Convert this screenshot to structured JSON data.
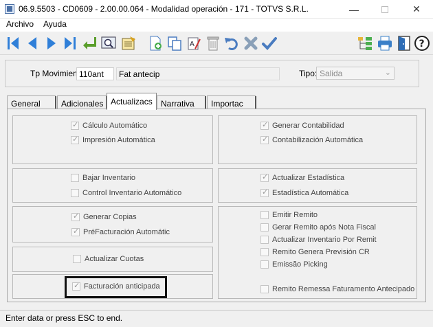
{
  "window": {
    "title": "06.9.5503 - CD0609 - 2.00.00.064 - Modalidad operación - 171 - TOTVS S.R.L.",
    "minimize": "—",
    "close": "✕"
  },
  "menu": [
    "Archivo",
    "Ayuda"
  ],
  "toolbar": {
    "icons": [
      "first-icon",
      "previous-icon",
      "next-icon",
      "last-icon",
      "return-icon",
      "search-icon",
      "list-icon",
      "new-icon",
      "copy-icon",
      "edit-text-icon",
      "delete-icon",
      "undo-icon",
      "cancel-icon",
      "confirm-icon",
      "tree-icon",
      "print-icon",
      "exit-icon",
      "help-icon"
    ],
    "colors": {
      "nav_blue": "#2f7fd8",
      "return_green": "#5a9e2b",
      "cancel_gray": "#8aa0b8"
    }
  },
  "header": {
    "tp_label": "Tp Movimien:",
    "tp_code": "110ant",
    "tp_desc": "Fat antecip",
    "tipo_label": "Tipo:",
    "tipo_value": "Salida"
  },
  "tabs": [
    "General",
    "Adicionales",
    "Actualizacs",
    "Narrativa",
    "Importac"
  ],
  "active_tab": "Actualizacs",
  "options": {
    "calculo": {
      "label": "Cálculo Automático",
      "checked": true
    },
    "impresion": {
      "label": "Impresión Automática",
      "checked": true
    },
    "gen_contab": {
      "label": "Generar Contabilidad",
      "checked": true
    },
    "contab_auto": {
      "label": "Contabilización Automática",
      "checked": true
    },
    "bajar_inv": {
      "label": "Bajar Inventario",
      "checked": false
    },
    "control_inv": {
      "label": "Control Inventario Automático",
      "checked": false
    },
    "act_estad": {
      "label": "Actualizar Estadística",
      "checked": true
    },
    "estad_auto": {
      "label": "Estadística Automática",
      "checked": true
    },
    "gen_copias": {
      "label": "Generar Copias",
      "checked": true
    },
    "prefact": {
      "label": "PréFacturación Automátic",
      "checked": true
    },
    "act_cuotas": {
      "label": "Actualizar Cuotas",
      "checked": false
    },
    "fact_antic": {
      "label": "Facturación anticipada",
      "checked": true
    },
    "emitir_remito": {
      "label": "Emitir Remito",
      "checked": false
    },
    "gerar_remito": {
      "label": "Gerar Remito após Nota Fiscal",
      "checked": false
    },
    "act_inv_remito": {
      "label": "Actualizar Inventario Por Remit",
      "checked": false
    },
    "remito_prevision": {
      "label": "Remito Genera Previsión CR",
      "checked": false
    },
    "emissao_picking": {
      "label": "Emissão Picking",
      "checked": false
    },
    "remito_remessa": {
      "label": "Remito Remessa Faturamento Antecipado",
      "checked": false
    }
  },
  "status": "Enter data or press ESC to end."
}
